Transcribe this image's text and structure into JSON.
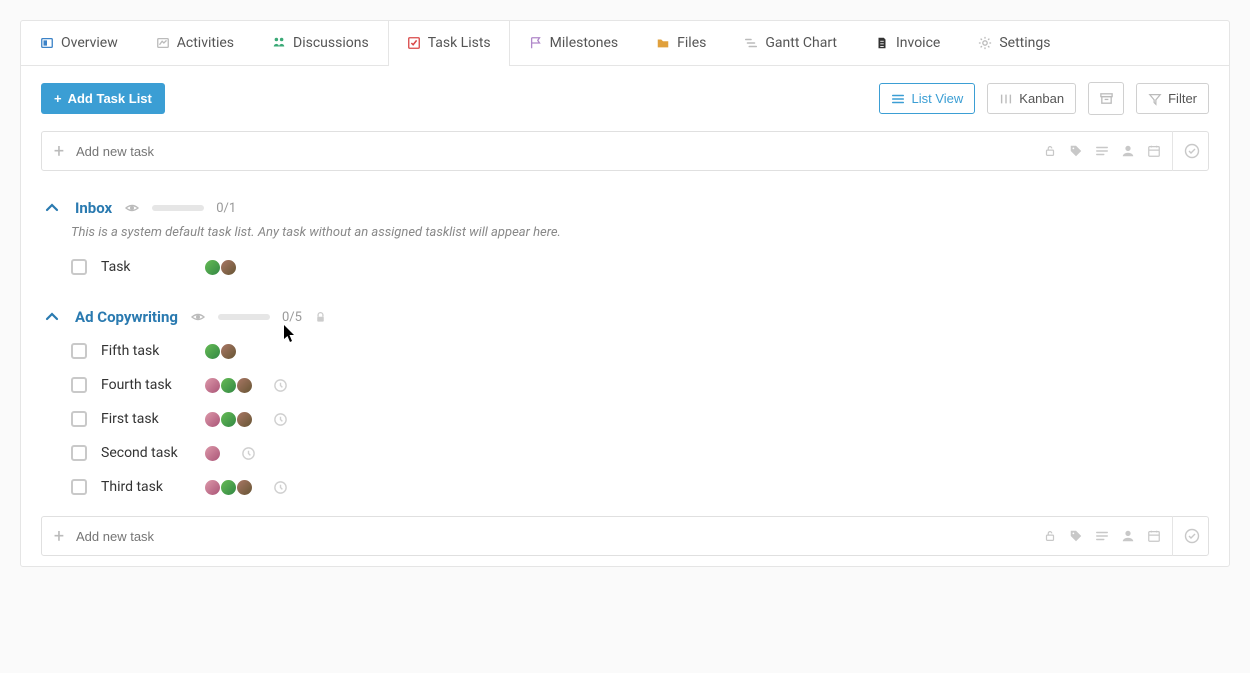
{
  "tabs": [
    {
      "label": "Overview",
      "icon": "overview",
      "color": "#3b82c7"
    },
    {
      "label": "Activities",
      "icon": "activities",
      "color": "#bbb"
    },
    {
      "label": "Discussions",
      "icon": "discussions",
      "color": "#3aa976"
    },
    {
      "label": "Task Lists",
      "icon": "tasklists",
      "color": "#d94747",
      "active": true
    },
    {
      "label": "Milestones",
      "icon": "milestones",
      "color": "#b088c9"
    },
    {
      "label": "Files",
      "icon": "files",
      "color": "#e0a03c"
    },
    {
      "label": "Gantt Chart",
      "icon": "gantt",
      "color": "#bbb"
    },
    {
      "label": "Invoice",
      "icon": "invoice",
      "color": "#333"
    },
    {
      "label": "Settings",
      "icon": "settings",
      "color": "#bbb"
    }
  ],
  "toolbar": {
    "add_task_list": "Add Task List",
    "list_view": "List View",
    "kanban": "Kanban",
    "filter": "Filter"
  },
  "new_task_placeholder": "Add new task",
  "lists": [
    {
      "key": "inbox",
      "title": "Inbox",
      "count": "0/1",
      "desc": "This is a system default task list. Any task without an assigned tasklist will appear here.",
      "locked": false,
      "tasks": [
        {
          "title": "Task",
          "avatars": [
            "green",
            "brown"
          ],
          "time": false
        }
      ]
    },
    {
      "key": "ad",
      "title": "Ad Copywriting",
      "count": "0/5",
      "desc": "",
      "locked": true,
      "tasks": [
        {
          "title": "Fifth task",
          "avatars": [
            "green",
            "brown"
          ],
          "time": false
        },
        {
          "title": "Fourth task",
          "avatars": [
            "pink",
            "green",
            "brown"
          ],
          "time": true
        },
        {
          "title": "First task",
          "avatars": [
            "pink",
            "green",
            "brown"
          ],
          "time": true
        },
        {
          "title": "Second task",
          "avatars": [
            "pink"
          ],
          "time": true
        },
        {
          "title": "Third task",
          "avatars": [
            "pink",
            "green",
            "brown"
          ],
          "time": true
        }
      ]
    }
  ]
}
